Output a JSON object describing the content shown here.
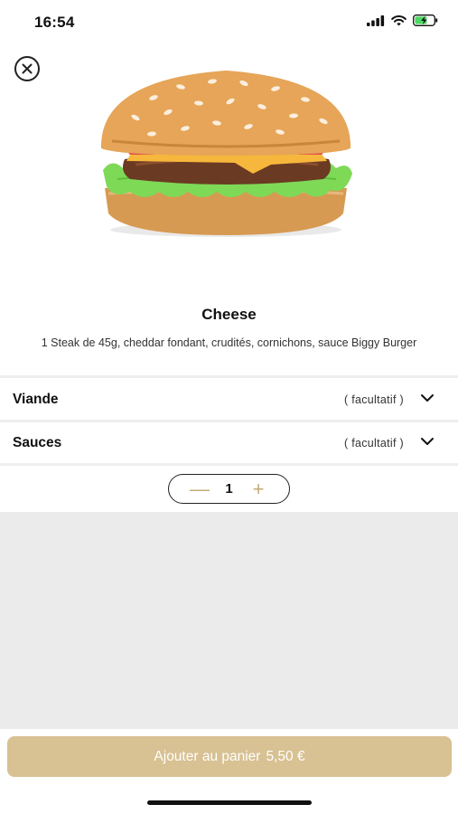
{
  "status_bar": {
    "time": "16:54"
  },
  "product": {
    "name": "Cheese",
    "description": "1 Steak de 45g, cheddar fondant, crudités, cornichons, sauce Biggy Burger"
  },
  "options": [
    {
      "label": "Viande",
      "hint": "( facultatif )"
    },
    {
      "label": "Sauces",
      "hint": "( facultatif )"
    }
  ],
  "stepper": {
    "quantity": "1",
    "minus": "—",
    "plus": "+"
  },
  "cart": {
    "label": "Ajouter au panier",
    "price": "5,50 €"
  },
  "colors": {
    "accent": "#d8c192",
    "stepper_accent": "#c6ac77",
    "grey_area": "#ebebeb"
  },
  "icons": [
    "signal-icon",
    "wifi-icon",
    "battery-charging-icon",
    "close-icon",
    "burger-image",
    "chevron-down-icon",
    "minus-icon",
    "plus-icon"
  ]
}
